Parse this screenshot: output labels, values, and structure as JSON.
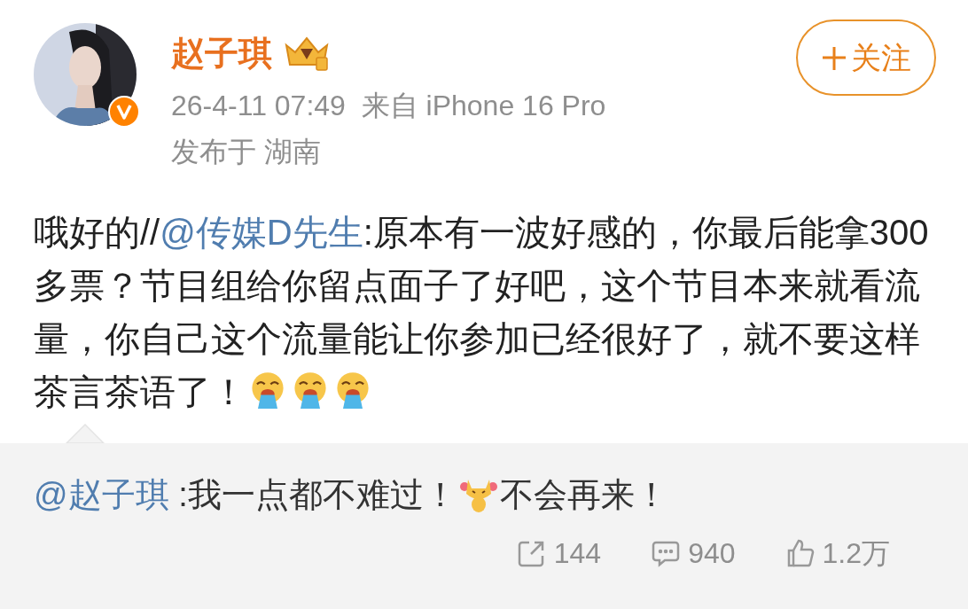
{
  "author": {
    "name": "赵子琪",
    "verified": true
  },
  "meta": {
    "time": "26-4-11 07:49",
    "source": "来自 iPhone 16 Pro",
    "location": "发布于 湖南"
  },
  "follow_button": {
    "label": "关注"
  },
  "post": {
    "parts": [
      {
        "kind": "text",
        "text": "哦好的//"
      },
      {
        "kind": "mention",
        "text": "@传媒D先生"
      },
      {
        "kind": "text",
        "text": ":原本有一波好感的，你最后能拿300多票？节目组给你留点面子了好吧，这个节目本来就看流量，你自己这个流量能让你参加已经很好了，就不要这样茶言茶语了！"
      },
      {
        "kind": "emoji"
      },
      {
        "kind": "emoji"
      },
      {
        "kind": "emoji"
      }
    ]
  },
  "retweet": {
    "parts": [
      {
        "kind": "mention",
        "text": "@赵子琪"
      },
      {
        "kind": "text",
        "text": " :我一点都不难过！"
      },
      {
        "kind": "emoji"
      },
      {
        "kind": "text",
        "text": "不会再来！"
      }
    ],
    "actions": [
      {
        "kind": "repost",
        "count": "144"
      },
      {
        "kind": "comment",
        "count": "940"
      },
      {
        "kind": "like",
        "count": "1.2万"
      }
    ]
  }
}
